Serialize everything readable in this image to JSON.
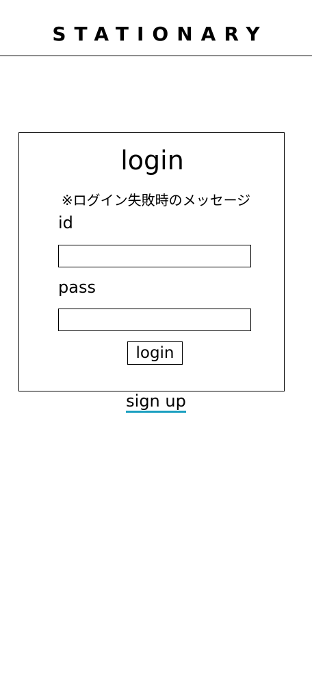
{
  "header": {
    "brand": "STATIONARY"
  },
  "login": {
    "title": "login",
    "error_message": "※ログイン失敗時のメッセージ",
    "id_label": "id",
    "id_value": "",
    "pass_label": "pass",
    "pass_value": "",
    "button_label": "login"
  },
  "signup": {
    "link_label": "sign up",
    "underline_color": "#1a9fc0"
  }
}
